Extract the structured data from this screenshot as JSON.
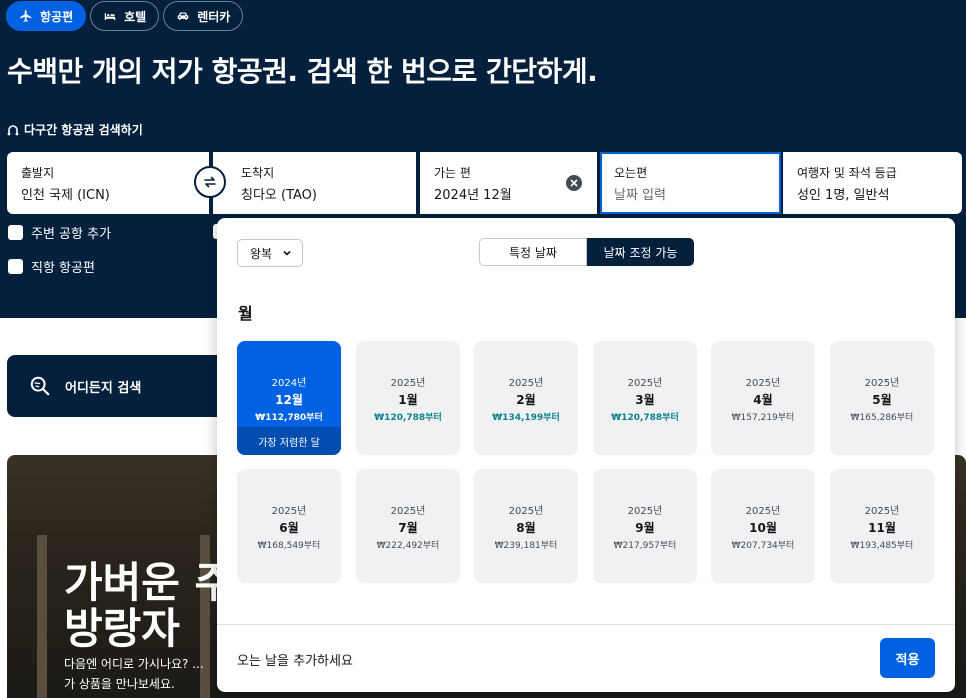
{
  "tabs": [
    {
      "label": "항공편",
      "icon": "plane-icon",
      "active": true
    },
    {
      "label": "호텔",
      "icon": "bed-icon",
      "active": false
    },
    {
      "label": "렌터카",
      "icon": "car-icon",
      "active": false
    }
  ],
  "headline": "수백만 개의 저가 항공권. 검색 한 번으로 간단하게.",
  "multi_city": {
    "label": "다구간 항공권 검색하기",
    "icon": "route-icon"
  },
  "search": {
    "origin": {
      "label": "출발지",
      "value": "인천 국제 (ICN)"
    },
    "destination": {
      "label": "도착지",
      "value": "칭다오 (TAO)"
    },
    "depart": {
      "label": "가는 편",
      "value": "2024년 12월"
    },
    "return": {
      "label": "오는편",
      "placeholder": "날짜 입력"
    },
    "travellers": {
      "label": "여행자 및 좌석 등급",
      "value": "성인 1명, 일반석"
    }
  },
  "checkboxes": {
    "nearby": "주변 공항 추가",
    "direct": "직항 항공편"
  },
  "explore": {
    "label": "어디든지 검색",
    "icon": "explore-search-icon"
  },
  "hero": {
    "title": "가벼운 주\n방랑자",
    "subtitle": "다음엔 어디로 가시나요? ...\n가 상품을 만나보세요."
  },
  "calendar": {
    "trip_type": "왕복",
    "segments": {
      "specific": "특정 날짜",
      "flexible": "날짜 조정 가능"
    },
    "section_title": "월",
    "months": [
      {
        "year": "2024년",
        "month": "12월",
        "price": "₩112,780부터",
        "selected": true,
        "tag": "가장 저렴한 달"
      },
      {
        "year": "2025년",
        "month": "1월",
        "price": "₩120,788부터",
        "cheap": true
      },
      {
        "year": "2025년",
        "month": "2월",
        "price": "₩134,199부터",
        "cheap": true
      },
      {
        "year": "2025년",
        "month": "3월",
        "price": "₩120,788부터",
        "cheap": true
      },
      {
        "year": "2025년",
        "month": "4월",
        "price": "₩157,219부터"
      },
      {
        "year": "2025년",
        "month": "5월",
        "price": "₩165,286부터"
      },
      {
        "year": "2025년",
        "month": "6월",
        "price": "₩168,549부터"
      },
      {
        "year": "2025년",
        "month": "7월",
        "price": "₩222,492부터"
      },
      {
        "year": "2025년",
        "month": "8월",
        "price": "₩239,181부터"
      },
      {
        "year": "2025년",
        "month": "9월",
        "price": "₩217,957부터"
      },
      {
        "year": "2025년",
        "month": "10월",
        "price": "₩207,734부터"
      },
      {
        "year": "2025년",
        "month": "11월",
        "price": "₩193,485부터"
      }
    ],
    "footer_text": "오는 날을 추가하세요",
    "apply_label": "적용"
  },
  "colors": {
    "brand_navy": "#05203c",
    "accent_blue": "#0062e3",
    "cheap_teal": "#0c838a"
  }
}
